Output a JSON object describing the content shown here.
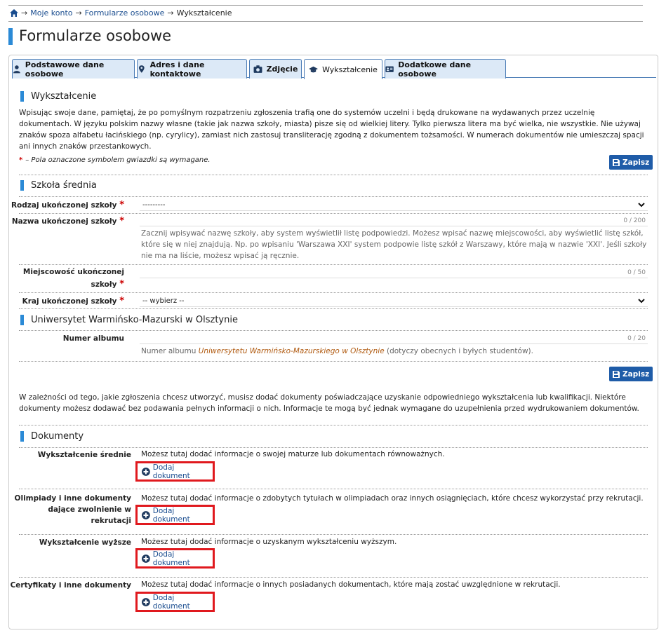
{
  "breadcrumb": {
    "home_icon": "home-icon",
    "arrow": "→",
    "items": [
      "Moje konto",
      "Formularze osobowe",
      "Wykształcenie"
    ]
  },
  "page": {
    "title": "Formularze osobowe"
  },
  "tabs": [
    {
      "label": "Podstawowe dane osobowe",
      "icon": "user-icon"
    },
    {
      "label": "Adres i dane kontaktowe",
      "icon": "map-marker-icon"
    },
    {
      "label": "Zdjęcie",
      "icon": "camera-icon"
    },
    {
      "label": "Wykształcenie",
      "icon": "graduation-cap-icon",
      "active": true
    },
    {
      "label": "Dodatkowe dane osobowe",
      "icon": "id-card-icon"
    }
  ],
  "education": {
    "heading": "Wykształcenie",
    "intro": "Wpisując swoje dane, pamiętaj, że po pomyślnym rozpatrzeniu zgłoszenia trafią one do systemów uczelni i będą drukowane na wydawanych przez uczelnię dokumentach. W języku polskim nazwy własne (takie jak nazwa szkoły, miasta) pisze się od wielkiej litery. Tylko pierwsza litera ma być wielka, nie wszystkie. Nie używaj znaków spoza alfabetu łacińskiego (np. cyrylicy), zamiast nich zastosuj transliterację zgodną z dokumentem tożsamości. W numerach dokumentów nie umieszczaj spacji ani innych znaków przestankowych.",
    "required_star": "*",
    "required_note": "– Pola oznaczone symbolem gwiazdki są wymagane.",
    "save_label": "Zapisz"
  },
  "high_school": {
    "heading": "Szkoła średnia",
    "school_type_label": "Rodzaj ukończonej szkoły",
    "school_type_value": "---------",
    "school_name_label": "Nazwa ukończonej szkoły",
    "school_name_counter": "0 / 200",
    "school_name_hint": "Zacznij wpisywać nazwę szkoły, aby system wyświetlił listę podpowiedzi. Możesz wpisać nazwę miejscowości, aby wyświetlić listę szkół, które się w niej znajdują. Np. po wpisaniu 'Warszawa XXI' system podpowie listę szkół z Warszawy, które mają w nazwie 'XXI'. Jeśli szkoły nie ma na liście, możesz wpisać ją ręcznie.",
    "city_label_1": "Miejscowość ukończonej",
    "city_label_2": "szkoły",
    "city_counter": "0 / 50",
    "country_label": "Kraj ukończonej szkoły",
    "country_value": "-- wybierz --",
    "star": "*"
  },
  "university": {
    "heading": "Uniwersytet Warmińsko-Mazurski w Olsztynie",
    "album_label": "Numer albumu",
    "album_counter": "0 / 20",
    "album_hint_pre": "Numer albumu ",
    "album_hint_link": "Uniwersytetu Warmińsko-Mazurskiego w Olsztynie",
    "album_hint_post": " (dotyczy obecnych i byłych studentów).",
    "save_label": "Zapisz"
  },
  "docs_intro": "W zależności od tego, jakie zgłoszenia chcesz utworzyć, musisz dodać dokumenty poświadczające uzyskanie odpowiedniego wykształcenia lub kwalifikacji. Niektóre dokumenty możesz dodawać bez podawania pełnych informacji o nich. Informacje te mogą być jednak wymagane do uzupełnienia przed wydrukowaniem dokumentów.",
  "documents": {
    "heading": "Dokumenty",
    "add_label": "Dodaj dokument",
    "items": [
      {
        "label": "Wykształcenie średnie",
        "text": "Możesz tutaj dodać informacje o swojej maturze lub dokumentach równoważnych."
      },
      {
        "label_1": "Olimpiady i inne dokumenty",
        "label_2": "dające zwolnienie w rekrutacji",
        "text": "Możesz tutaj dodać informacje o zdobytych tytułach w olimpiadach oraz innych osiągnięciach, które chcesz wykorzystać przy rekrutacji."
      },
      {
        "label": "Wykształcenie wyższe",
        "text": "Możesz tutaj dodać informacje o uzyskanym wykształceniu wyższym."
      },
      {
        "label": "Certyfikaty i inne dokumenty",
        "text": "Możesz tutaj dodać informacje o innych posiadanych dokumentach, które mają zostać uwzględnione w rekrutacji."
      }
    ]
  },
  "colors": {
    "accent": "#2b8ad6",
    "button": "#1f5ca8",
    "highlight": "#e0191e",
    "required": "#cc0000"
  }
}
